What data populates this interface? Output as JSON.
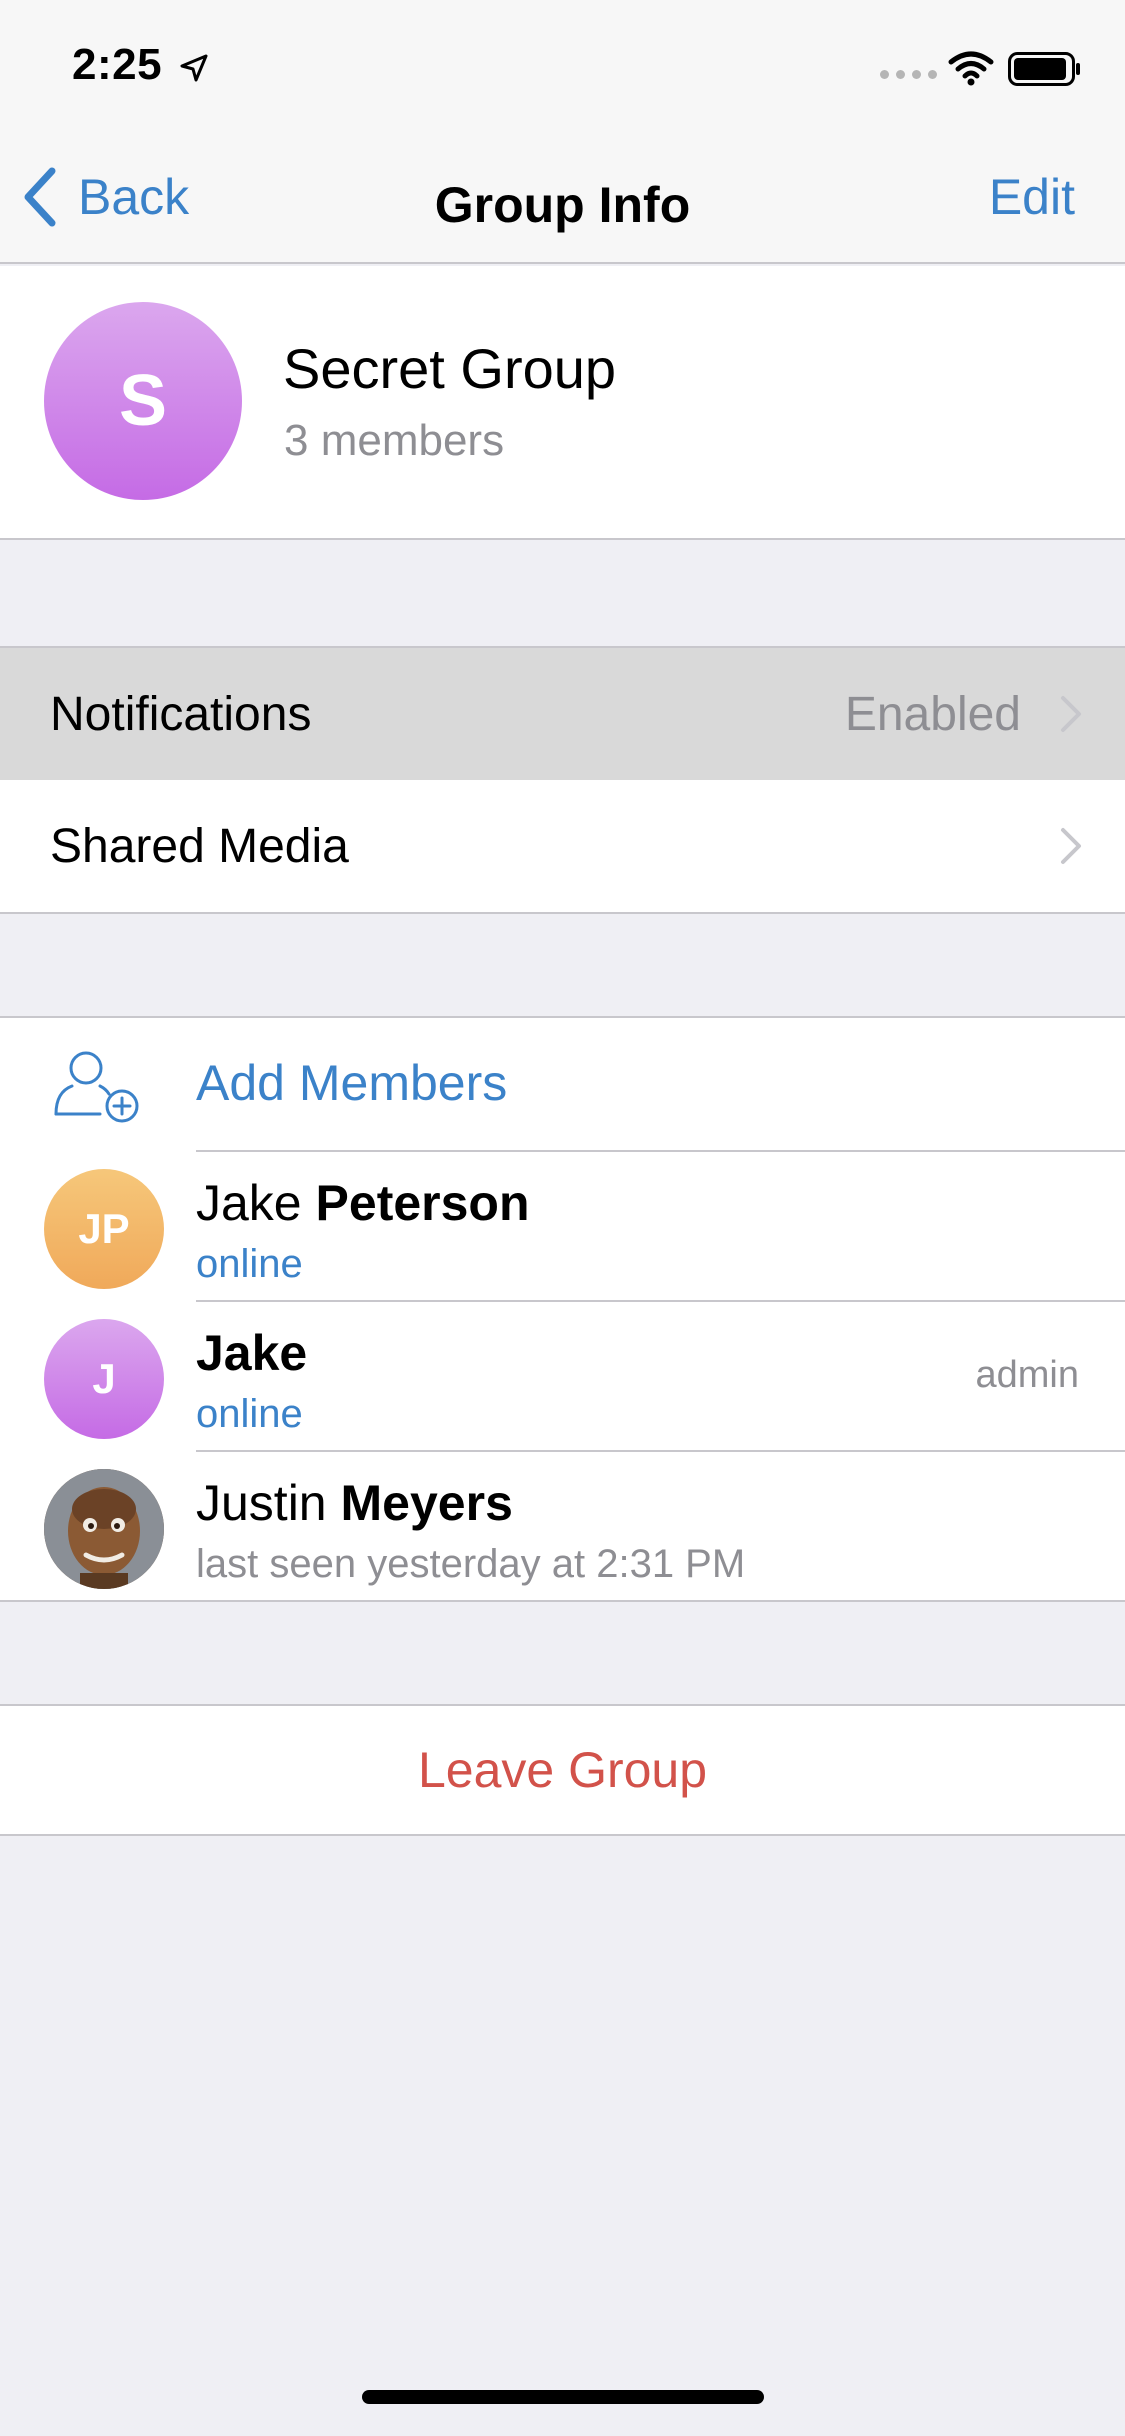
{
  "status_bar": {
    "time": "2:25",
    "icons": [
      "location-arrow-icon",
      "cellular-signal-icon",
      "wifi-icon",
      "battery-icon"
    ]
  },
  "nav": {
    "back_label": "Back",
    "title": "Group Info",
    "edit_label": "Edit"
  },
  "group": {
    "avatar_initial": "S",
    "name": "Secret Group",
    "members_count": "3 members"
  },
  "settings": {
    "notifications": {
      "label": "Notifications",
      "value": "Enabled"
    },
    "shared_media": {
      "label": "Shared Media"
    }
  },
  "members": {
    "add_label": "Add Members",
    "list": [
      {
        "initials": "JP",
        "first": "Jake",
        "last": "Peterson",
        "status": "online",
        "role": ""
      },
      {
        "initials": "J",
        "first": "Jake",
        "last": "",
        "status": "online",
        "role": "admin"
      },
      {
        "initials": "",
        "first": "Justin",
        "last": "Meyers",
        "status": "last seen yesterday at 2:31 PM",
        "role": ""
      }
    ]
  },
  "leave_label": "Leave Group",
  "colors": {
    "accent": "#3b82c9",
    "destructive": "#d2524a",
    "group_avatar": "#c56be5",
    "jp_avatar": "#f2b060"
  }
}
